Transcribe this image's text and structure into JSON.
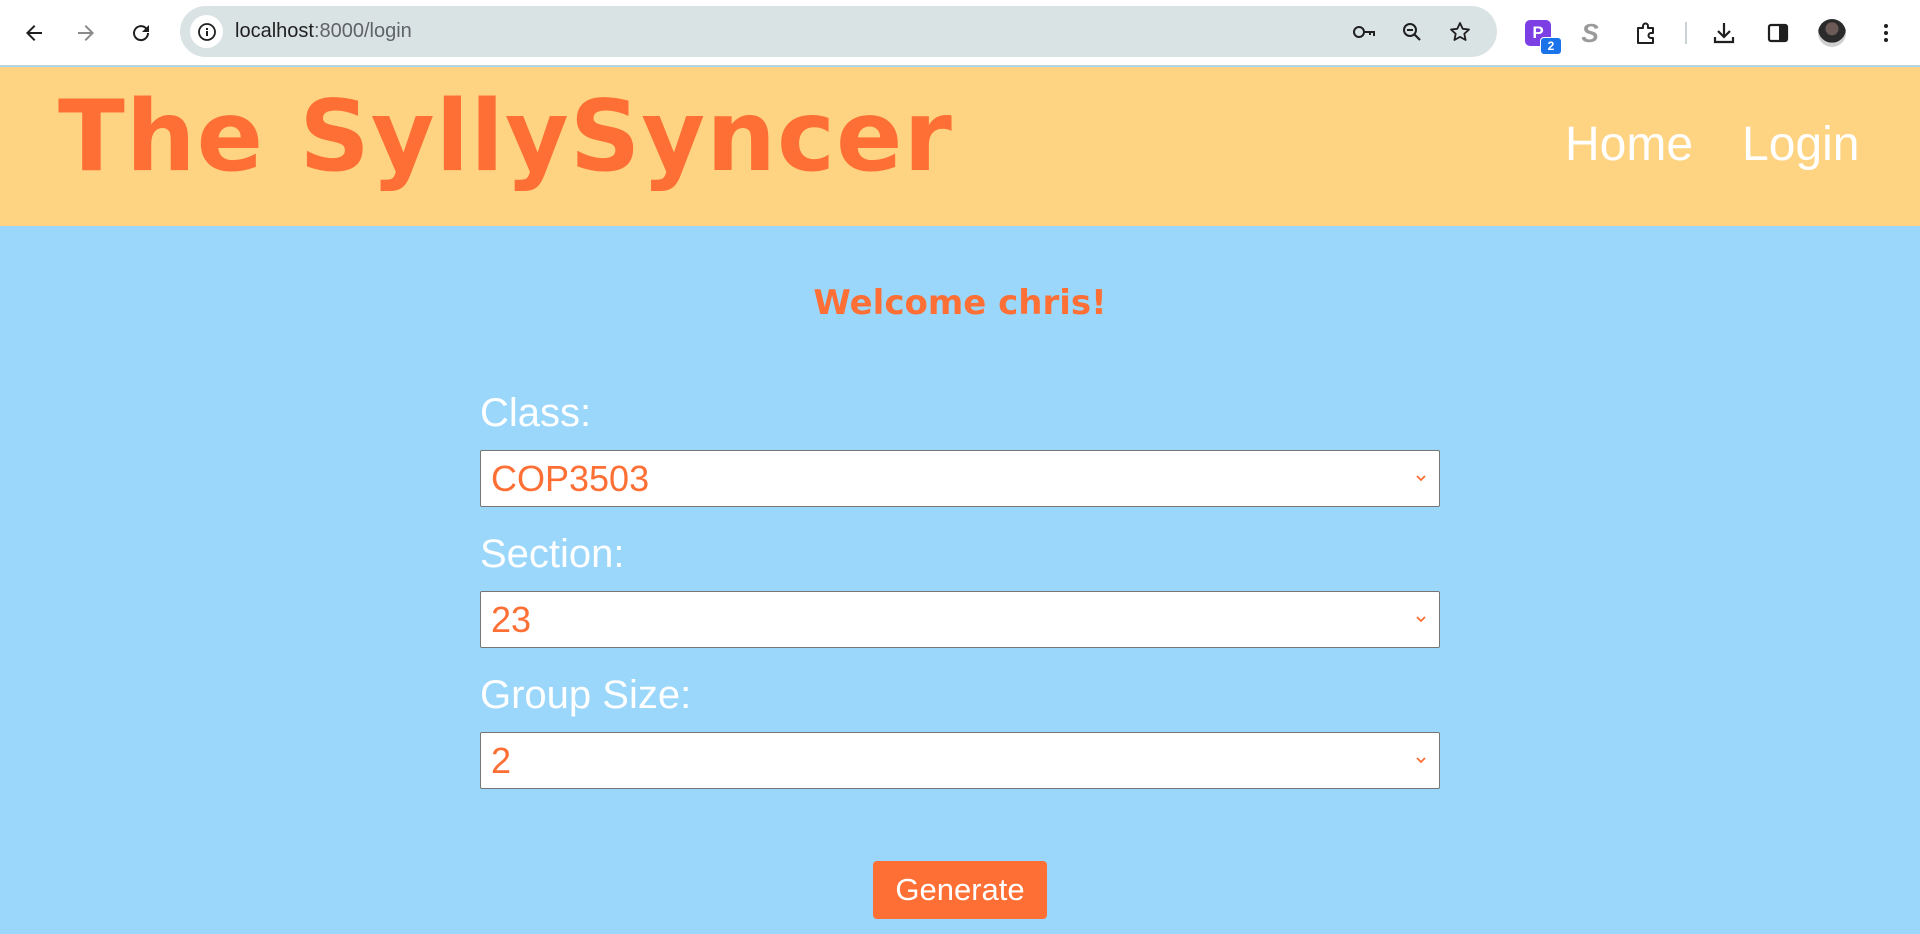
{
  "browser": {
    "url_host": "localhost",
    "url_path": ":8000/login",
    "extension_badge": "2",
    "extension_p_letter": "P",
    "extension_s_letter": "S",
    "icons": [
      "back-icon",
      "forward-icon",
      "reload-icon",
      "info-icon",
      "key-icon",
      "zoom-icon",
      "star-icon",
      "extensions-icon",
      "download-icon",
      "side-panel-icon",
      "avatar",
      "menu-icon"
    ]
  },
  "header": {
    "logo": "The SyllySyncer",
    "nav": {
      "home": "Home",
      "login": "Login"
    }
  },
  "main": {
    "welcome": "Welcome chris!",
    "class_label": "Class:",
    "class_value": "COP3503",
    "section_label": "Section:",
    "section_value": "23",
    "group_size_label": "Group Size:",
    "group_size_value": "2",
    "generate_label": "Generate"
  },
  "colors": {
    "page_bg": "#9ad7fb",
    "header_bg": "#fed483",
    "accent": "#fd6f34"
  }
}
